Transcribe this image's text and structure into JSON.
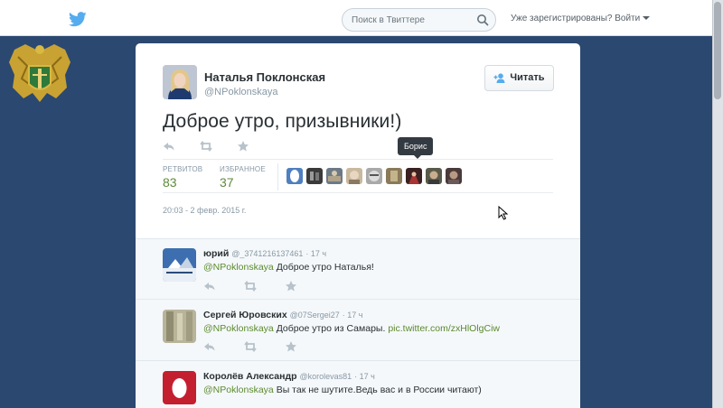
{
  "topbar": {
    "search_placeholder": "Поиск в Твиттере",
    "login_label": "Уже зарегистрированы? Войти"
  },
  "tweet": {
    "author_name": "Наталья Поклонская",
    "author_handle": "@NPoklonskaya",
    "follow_label": "Читать",
    "text": "Доброе утро, призывники!)",
    "retweets_label": "РЕТВИТОВ",
    "retweets_count": "83",
    "favorites_label": "ИЗБРАННОЕ",
    "favorites_count": "37",
    "tooltip": "Борис",
    "timestamp": "20:03 - 2 февр. 2015 г."
  },
  "replies": [
    {
      "name": "юрий",
      "handle": "@_3741216137461",
      "time": "17 ч",
      "mention": "@NPoklonskaya",
      "text": "Доброе утро Наталья!"
    },
    {
      "name": "Сергей Юровских",
      "handle": "@07Sergei27",
      "time": "17 ч",
      "mention": "@NPoklonskaya",
      "text": "Доброе утро из Самары.",
      "link": "pic.twitter.com/zxHlOlgCiw"
    },
    {
      "name": "Королёв Александр",
      "handle": "@korolevas81",
      "time": "17 ч",
      "mention": "@NPoklonskaya",
      "text": "Вы так не шутите.Ведь вас и в России читают)"
    }
  ],
  "icons": [
    "twitter-bird-icon",
    "search-icon",
    "caret-down-icon",
    "follow-user-icon",
    "reply-icon",
    "retweet-icon",
    "favorite-icon",
    "mouse-cursor-icon"
  ],
  "colors": {
    "background": "#2b4870",
    "mention_link": "#5a8a2e",
    "muted": "#8899a6",
    "twitter_blue": "#55acee"
  }
}
